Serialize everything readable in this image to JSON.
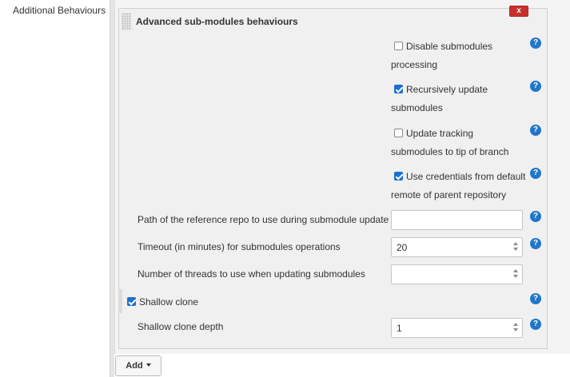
{
  "section": {
    "label": "Additional Behaviours"
  },
  "panel": {
    "title": "Advanced sub-modules behaviours",
    "close_label": "x"
  },
  "checkboxes": [
    {
      "line1": "Disable submodules",
      "line2": "processing",
      "checked": false
    },
    {
      "line1": "Recursively update",
      "line2": "submodules",
      "checked": true
    },
    {
      "line1": "Update tracking",
      "line2": "submodules to tip of branch",
      "checked": false
    },
    {
      "line1": "Use credentials from default",
      "line2": "remote of parent repository",
      "checked": true
    }
  ],
  "fields": {
    "reference_repo": {
      "label": "Path of the reference repo to use during submodule update",
      "value": ""
    },
    "timeout": {
      "label": "Timeout (in minutes) for submodules operations",
      "value": "20"
    },
    "threads": {
      "label": "Number of threads to use when updating submodules",
      "value": ""
    },
    "shallow_clone": {
      "label": "Shallow clone",
      "checked": true
    },
    "shallow_depth": {
      "label": "Shallow clone depth",
      "value": "1"
    }
  },
  "help_glyph": "?",
  "add_button": {
    "label": "Add"
  },
  "colors": {
    "help": "#1f77c9",
    "close": "#c9302c",
    "checkbox": "#1b6fd1"
  }
}
